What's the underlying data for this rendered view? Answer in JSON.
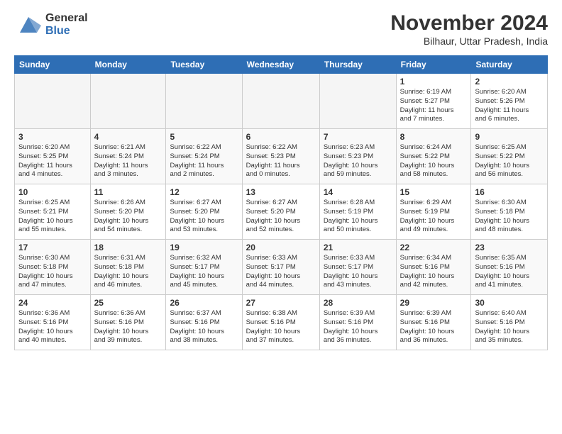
{
  "header": {
    "logo_general": "General",
    "logo_blue": "Blue",
    "month_title": "November 2024",
    "subtitle": "Bilhaur, Uttar Pradesh, India"
  },
  "calendar": {
    "days_of_week": [
      "Sunday",
      "Monday",
      "Tuesday",
      "Wednesday",
      "Thursday",
      "Friday",
      "Saturday"
    ],
    "weeks": [
      [
        {
          "day": "",
          "info": ""
        },
        {
          "day": "",
          "info": ""
        },
        {
          "day": "",
          "info": ""
        },
        {
          "day": "",
          "info": ""
        },
        {
          "day": "",
          "info": ""
        },
        {
          "day": "1",
          "info": "Sunrise: 6:19 AM\nSunset: 5:27 PM\nDaylight: 11 hours\nand 7 minutes."
        },
        {
          "day": "2",
          "info": "Sunrise: 6:20 AM\nSunset: 5:26 PM\nDaylight: 11 hours\nand 6 minutes."
        }
      ],
      [
        {
          "day": "3",
          "info": "Sunrise: 6:20 AM\nSunset: 5:25 PM\nDaylight: 11 hours\nand 4 minutes."
        },
        {
          "day": "4",
          "info": "Sunrise: 6:21 AM\nSunset: 5:24 PM\nDaylight: 11 hours\nand 3 minutes."
        },
        {
          "day": "5",
          "info": "Sunrise: 6:22 AM\nSunset: 5:24 PM\nDaylight: 11 hours\nand 2 minutes."
        },
        {
          "day": "6",
          "info": "Sunrise: 6:22 AM\nSunset: 5:23 PM\nDaylight: 11 hours\nand 0 minutes."
        },
        {
          "day": "7",
          "info": "Sunrise: 6:23 AM\nSunset: 5:23 PM\nDaylight: 10 hours\nand 59 minutes."
        },
        {
          "day": "8",
          "info": "Sunrise: 6:24 AM\nSunset: 5:22 PM\nDaylight: 10 hours\nand 58 minutes."
        },
        {
          "day": "9",
          "info": "Sunrise: 6:25 AM\nSunset: 5:22 PM\nDaylight: 10 hours\nand 56 minutes."
        }
      ],
      [
        {
          "day": "10",
          "info": "Sunrise: 6:25 AM\nSunset: 5:21 PM\nDaylight: 10 hours\nand 55 minutes."
        },
        {
          "day": "11",
          "info": "Sunrise: 6:26 AM\nSunset: 5:20 PM\nDaylight: 10 hours\nand 54 minutes."
        },
        {
          "day": "12",
          "info": "Sunrise: 6:27 AM\nSunset: 5:20 PM\nDaylight: 10 hours\nand 53 minutes."
        },
        {
          "day": "13",
          "info": "Sunrise: 6:27 AM\nSunset: 5:20 PM\nDaylight: 10 hours\nand 52 minutes."
        },
        {
          "day": "14",
          "info": "Sunrise: 6:28 AM\nSunset: 5:19 PM\nDaylight: 10 hours\nand 50 minutes."
        },
        {
          "day": "15",
          "info": "Sunrise: 6:29 AM\nSunset: 5:19 PM\nDaylight: 10 hours\nand 49 minutes."
        },
        {
          "day": "16",
          "info": "Sunrise: 6:30 AM\nSunset: 5:18 PM\nDaylight: 10 hours\nand 48 minutes."
        }
      ],
      [
        {
          "day": "17",
          "info": "Sunrise: 6:30 AM\nSunset: 5:18 PM\nDaylight: 10 hours\nand 47 minutes."
        },
        {
          "day": "18",
          "info": "Sunrise: 6:31 AM\nSunset: 5:18 PM\nDaylight: 10 hours\nand 46 minutes."
        },
        {
          "day": "19",
          "info": "Sunrise: 6:32 AM\nSunset: 5:17 PM\nDaylight: 10 hours\nand 45 minutes."
        },
        {
          "day": "20",
          "info": "Sunrise: 6:33 AM\nSunset: 5:17 PM\nDaylight: 10 hours\nand 44 minutes."
        },
        {
          "day": "21",
          "info": "Sunrise: 6:33 AM\nSunset: 5:17 PM\nDaylight: 10 hours\nand 43 minutes."
        },
        {
          "day": "22",
          "info": "Sunrise: 6:34 AM\nSunset: 5:16 PM\nDaylight: 10 hours\nand 42 minutes."
        },
        {
          "day": "23",
          "info": "Sunrise: 6:35 AM\nSunset: 5:16 PM\nDaylight: 10 hours\nand 41 minutes."
        }
      ],
      [
        {
          "day": "24",
          "info": "Sunrise: 6:36 AM\nSunset: 5:16 PM\nDaylight: 10 hours\nand 40 minutes."
        },
        {
          "day": "25",
          "info": "Sunrise: 6:36 AM\nSunset: 5:16 PM\nDaylight: 10 hours\nand 39 minutes."
        },
        {
          "day": "26",
          "info": "Sunrise: 6:37 AM\nSunset: 5:16 PM\nDaylight: 10 hours\nand 38 minutes."
        },
        {
          "day": "27",
          "info": "Sunrise: 6:38 AM\nSunset: 5:16 PM\nDaylight: 10 hours\nand 37 minutes."
        },
        {
          "day": "28",
          "info": "Sunrise: 6:39 AM\nSunset: 5:16 PM\nDaylight: 10 hours\nand 36 minutes."
        },
        {
          "day": "29",
          "info": "Sunrise: 6:39 AM\nSunset: 5:16 PM\nDaylight: 10 hours\nand 36 minutes."
        },
        {
          "day": "30",
          "info": "Sunrise: 6:40 AM\nSunset: 5:16 PM\nDaylight: 10 hours\nand 35 minutes."
        }
      ]
    ]
  }
}
